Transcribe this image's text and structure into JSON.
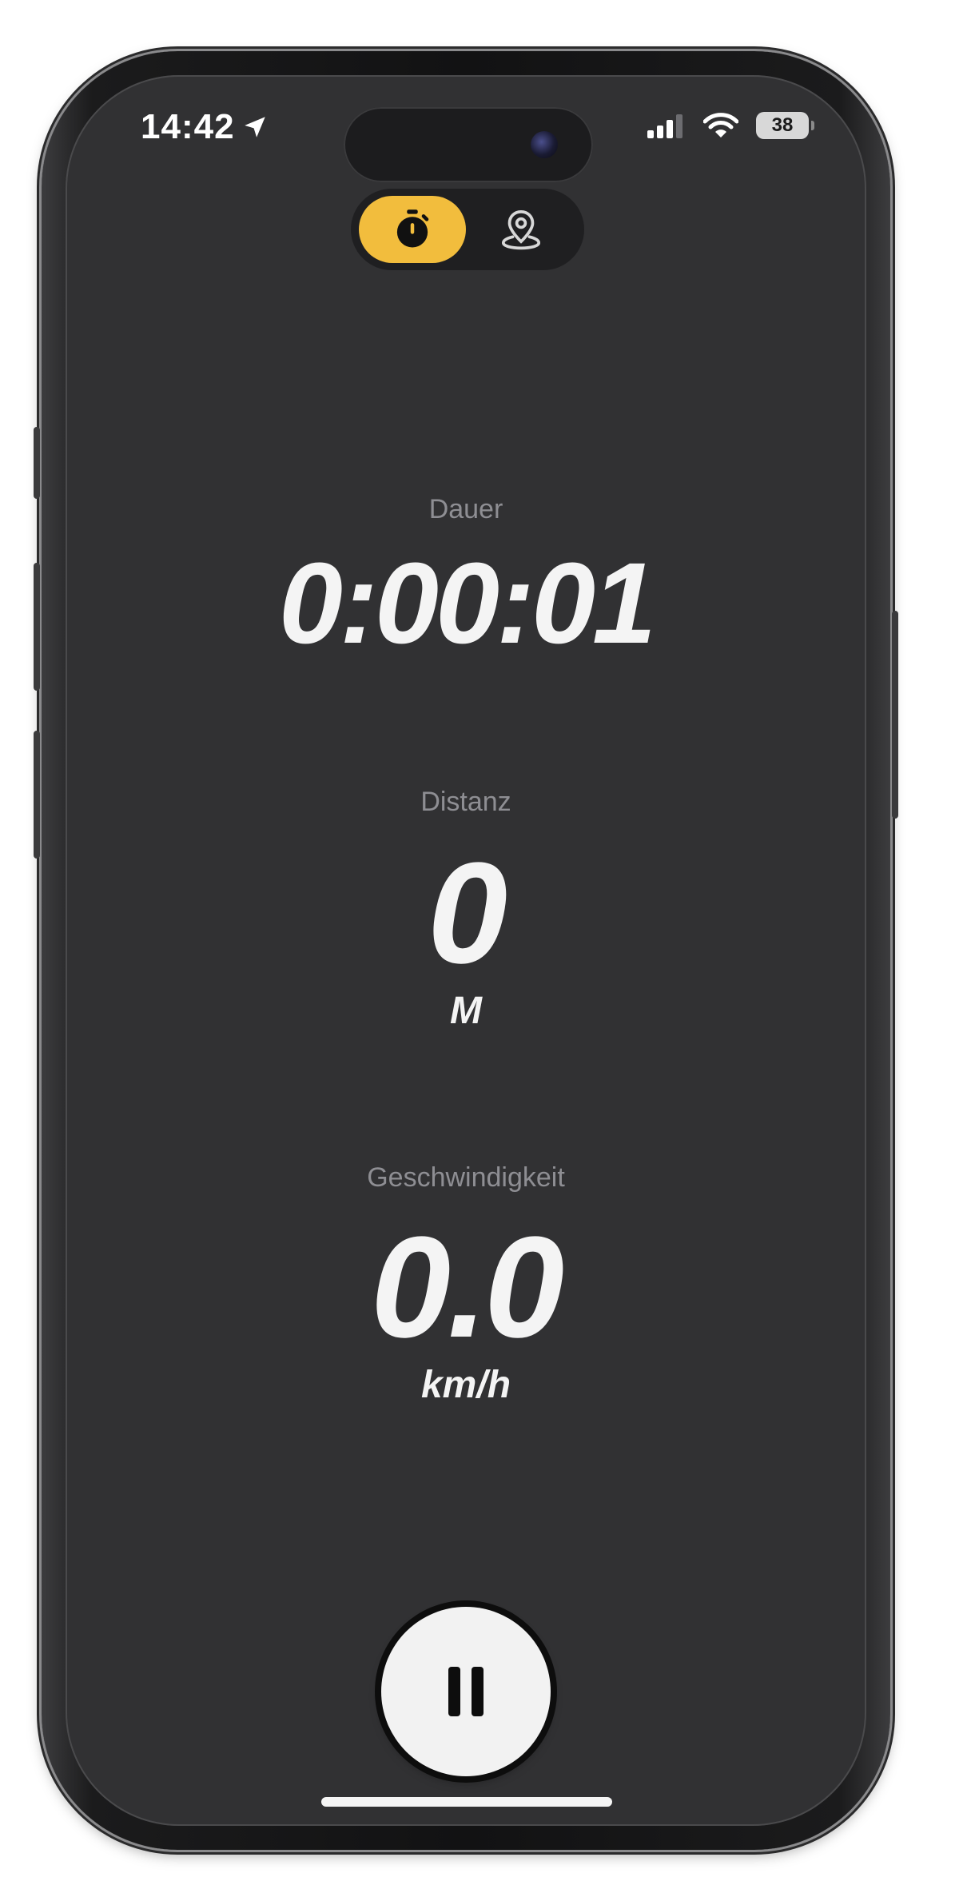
{
  "status_bar": {
    "time": "14:42",
    "battery": "38"
  },
  "mode_switch": {
    "options": [
      {
        "icon": "stopwatch-icon",
        "selected": true
      },
      {
        "icon": "map-pin-icon",
        "selected": false
      }
    ]
  },
  "metrics": {
    "duration": {
      "label": "Dauer",
      "value": "0:00:01"
    },
    "distance": {
      "label": "Distanz",
      "value": "0",
      "unit": "M"
    },
    "speed": {
      "label": "Geschwindigkeit",
      "value": "0.0",
      "unit": "km/h"
    }
  },
  "controls": {
    "pause_icon": "pause-icon"
  },
  "colors": {
    "accent": "#f2bd3d",
    "background": "#313133",
    "label": "#8e8e93",
    "value": "#f4f4f4"
  }
}
